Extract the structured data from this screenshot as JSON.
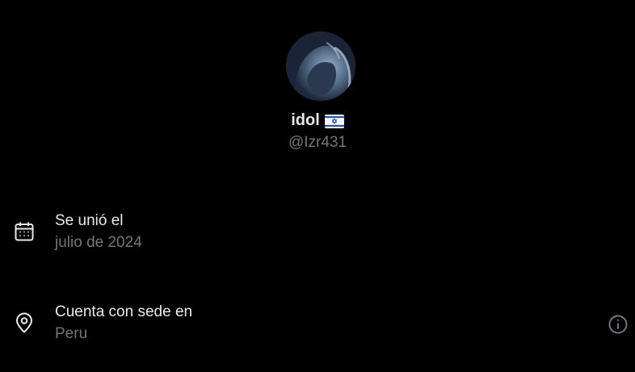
{
  "profile": {
    "display_name": "idol",
    "flag_icon": "israel-flag-icon",
    "handle": "@Izr431"
  },
  "joined": {
    "icon": "calendar-icon",
    "title": "Se unió el",
    "value": "julio de 2024"
  },
  "location": {
    "icon": "location-pin-icon",
    "title": "Cuenta con sede en",
    "value": "Peru",
    "info_icon": "info-icon"
  },
  "colors": {
    "background": "#000000",
    "primary_text": "#e7e9ea",
    "secondary_text": "#71767b"
  }
}
